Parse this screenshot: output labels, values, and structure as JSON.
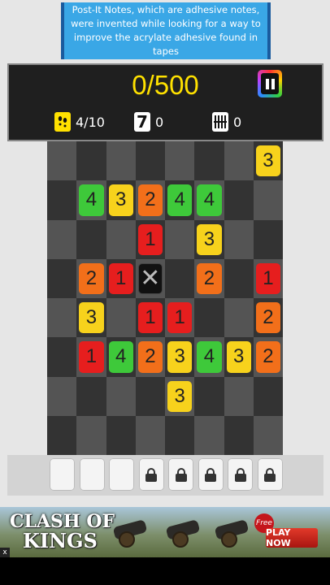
{
  "fact": {
    "text": "Post-It Notes, which are adhesive notes, were invented while looking for a way to improve the acrylate adhesive found in tapes"
  },
  "score": {
    "text": "0/500"
  },
  "stats": {
    "stars": {
      "icon": "footprint-icon",
      "value": "4/10"
    },
    "sevens": {
      "icon": "seven-tile-icon",
      "icon_text": "7",
      "value": "0"
    },
    "bars": {
      "icon": "bars-icon",
      "value": "0"
    }
  },
  "board": {
    "rows": 8,
    "cols": 8,
    "tiles": [
      [
        null,
        null,
        null,
        null,
        null,
        null,
        null,
        "3"
      ],
      [
        null,
        "4",
        "3",
        "2",
        "4",
        "4",
        null,
        null
      ],
      [
        null,
        null,
        null,
        "1",
        null,
        "3",
        null,
        null
      ],
      [
        null,
        "2",
        "1",
        "X",
        null,
        "2",
        null,
        "1"
      ],
      [
        null,
        "3",
        null,
        "1",
        "1",
        null,
        null,
        "2"
      ],
      [
        null,
        "1",
        "4",
        "2",
        "3",
        "4",
        "3",
        "2"
      ],
      [
        null,
        null,
        null,
        null,
        "3",
        null,
        null,
        null
      ],
      [
        null,
        null,
        null,
        null,
        null,
        null,
        null,
        null
      ]
    ],
    "colors": {
      "1": "#e61e1e",
      "2": "#f26f1a",
      "3": "#f7d21c",
      "4": "#3ec93a"
    }
  },
  "tray": {
    "slots": [
      {
        "locked": false
      },
      {
        "locked": false
      },
      {
        "locked": false
      },
      {
        "locked": true
      },
      {
        "locked": true
      },
      {
        "locked": true
      },
      {
        "locked": true
      },
      {
        "locked": true
      }
    ]
  },
  "ad": {
    "brand_line1": "CLASH OF",
    "brand_line2": "KINGS",
    "badge": "Free",
    "cta": "PLAY NOW",
    "close": "x"
  }
}
